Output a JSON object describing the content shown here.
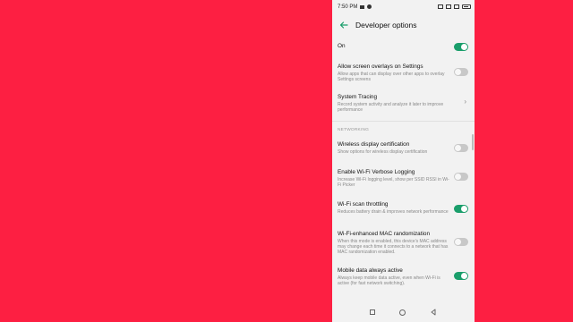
{
  "status": {
    "time": "7:50 PM"
  },
  "appbar": {
    "title": "Developer options"
  },
  "master": {
    "label": "On",
    "state": "on"
  },
  "items": [
    {
      "label": "Allow screen overlays on Settings",
      "sub": "Allow apps that can display over other apps to overlay Settings screens",
      "control": "toggle",
      "state": "off"
    },
    {
      "label": "System Tracing",
      "sub": "Record system activity and analyze it later to improve performance",
      "control": "chevron"
    }
  ],
  "section": {
    "label": "NETWORKING"
  },
  "networking": [
    {
      "label": "Wireless display certification",
      "sub": "Show options for wireless display certification",
      "state": "off"
    },
    {
      "label": "Enable Wi-Fi Verbose Logging",
      "sub": "Increase Wi-Fi logging level, show per SSID RSSI in Wi-Fi Picker",
      "state": "off"
    },
    {
      "label": "Wi-Fi scan throttling",
      "sub": "Reduces battery drain & improves network performance",
      "state": "on"
    },
    {
      "label": "Wi-Fi-enhanced MAC randomization",
      "sub": "When this mode is enabled, this device's MAC address may change each time it connects to a network that has MAC randomization enabled.",
      "state": "off"
    },
    {
      "label": "Mobile data always active",
      "sub": "Always keep mobile data active, even when Wi-Fi is active (for fast network switching).",
      "state": "on"
    }
  ],
  "colors": {
    "background": "#fd1f42",
    "accent": "#1a9e6b",
    "screen": "#f2f2f2"
  },
  "icons": {
    "back": "arrow-left-icon",
    "chevron": "chevron-right-icon",
    "nav_recents": "square-icon",
    "nav_home": "circle-icon",
    "nav_back": "triangle-back-icon"
  }
}
